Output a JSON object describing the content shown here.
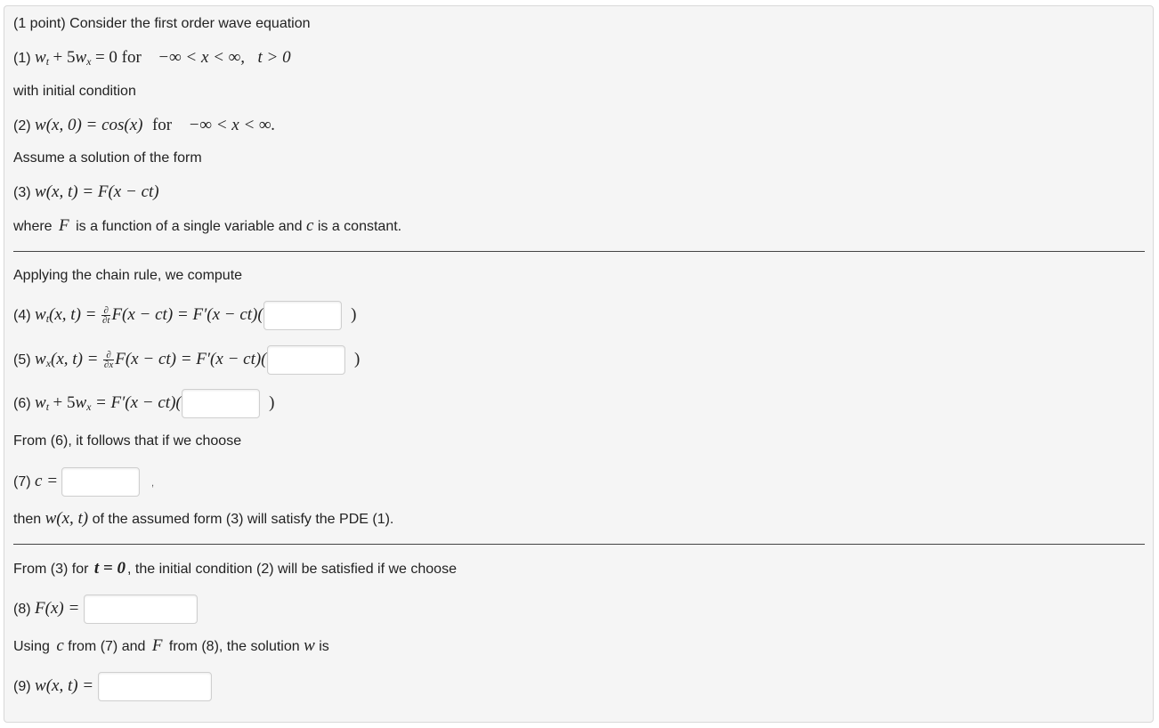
{
  "intro": {
    "point": "(1 point)",
    "text": "Consider the first order wave equation"
  },
  "eq1": {
    "tag": "(1)",
    "mid": "for",
    "domain": "−∞ < x < ∞,",
    "tcond": "t > 0"
  },
  "ic_text": "with initial condition",
  "eq2": {
    "tag": "(2)",
    "lhs": "w(x, 0) = cos(x)",
    "mid": "for",
    "domain": "−∞ < x < ∞."
  },
  "assume_text": "Assume a solution of the form",
  "eq3": {
    "tag": "(3)",
    "expr": "w(x, t) = F(x − ct)"
  },
  "where": {
    "pre": "where",
    "F": "F",
    "mid": "is a function of a single variable and",
    "c": "c",
    "post": "is a constant."
  },
  "chain_text": "Applying the chain rule, we compute",
  "eq4": {
    "tag": "(4)",
    "lhs": "(x, t) =",
    "frac_num": "∂",
    "frac_den": "∂t",
    "rhs": "F(x − ct) = F′(x − ct)(",
    "close": ")"
  },
  "eq5": {
    "tag": "(5)",
    "lhs": "(x, t) =",
    "frac_num": "∂",
    "frac_den": "∂x",
    "rhs": "F(x − ct) = F′(x − ct)(",
    "close": ")"
  },
  "eq6": {
    "tag": "(6)",
    "rhs": "= F′(x − ct)(",
    "close": ")"
  },
  "from6_text": "From (6), it follows that if we choose",
  "eq7": {
    "tag": "(7)",
    "expr": "c =",
    "after": ","
  },
  "then": {
    "pre": "then",
    "expr": "w(x, t)",
    "post": "of the assumed form (3) will satisfy the PDE (1)."
  },
  "from3": {
    "pre": "From (3) for",
    "expr": "t = 0",
    "post": ", the initial condition (2) will be satisfied if we choose"
  },
  "eq8": {
    "tag": "(8)",
    "expr": "F(x) ="
  },
  "using": {
    "pre": "Using",
    "c": "c",
    "mid1": "from (7) and",
    "F": "F",
    "mid2": "from (8), the solution",
    "w": "w",
    "post": "is"
  },
  "eq9": {
    "tag": "(9)",
    "expr": "w(x, t) ="
  },
  "answers": {
    "a4": "",
    "a5": "",
    "a6": "",
    "a7": "",
    "a8": "",
    "a9": ""
  }
}
